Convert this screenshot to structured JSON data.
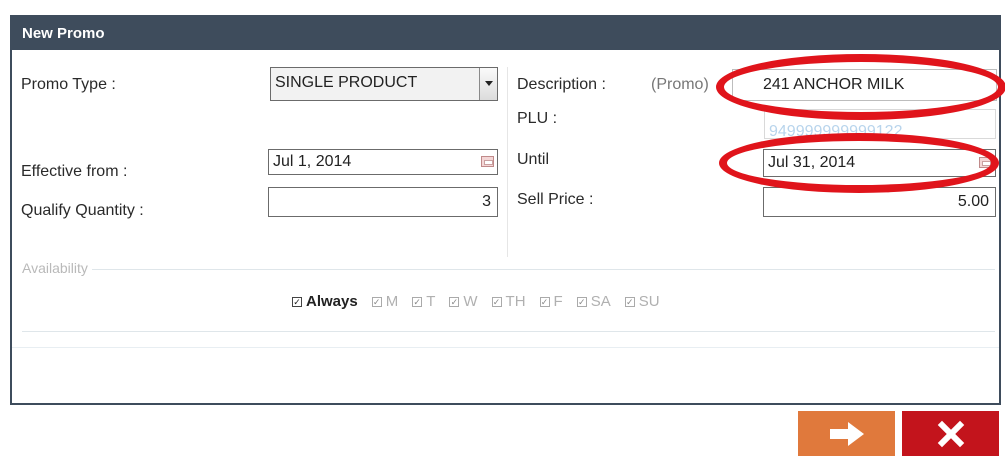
{
  "dialog": {
    "title": "New Promo"
  },
  "form": {
    "promo_type_label": "Promo Type :",
    "promo_type_value": "SINGLE PRODUCT",
    "description_label": "Description :",
    "description_prefix": "(Promo)",
    "description_value": "241 ANCHOR MILK",
    "plu_label": "PLU :",
    "plu_value": "949999999999122",
    "effective_from_label": "Effective from :",
    "effective_from_value": "Jul 1, 2014",
    "until_label": "Until",
    "until_value": "Jul 31, 2014",
    "qualify_quantity_label": "Qualify Quantity :",
    "qualify_quantity_value": "3",
    "sell_price_label": "Sell Price :",
    "sell_price_value": "5.00"
  },
  "availability": {
    "legend": "Availability",
    "options": [
      {
        "label": "Always",
        "checked": true
      },
      {
        "label": "M",
        "checked": true
      },
      {
        "label": "T",
        "checked": true
      },
      {
        "label": "W",
        "checked": true
      },
      {
        "label": "TH",
        "checked": true
      },
      {
        "label": "F",
        "checked": true
      },
      {
        "label": "SA",
        "checked": true
      },
      {
        "label": "SU",
        "checked": true
      }
    ]
  },
  "actions": {
    "next_icon": "arrow-right-icon",
    "close_icon": "close-x-icon"
  },
  "colors": {
    "titlebar": "#3e4c5c",
    "next_button": "#e0793c",
    "close_button": "#c3141c",
    "annotation": "#e0141b"
  }
}
